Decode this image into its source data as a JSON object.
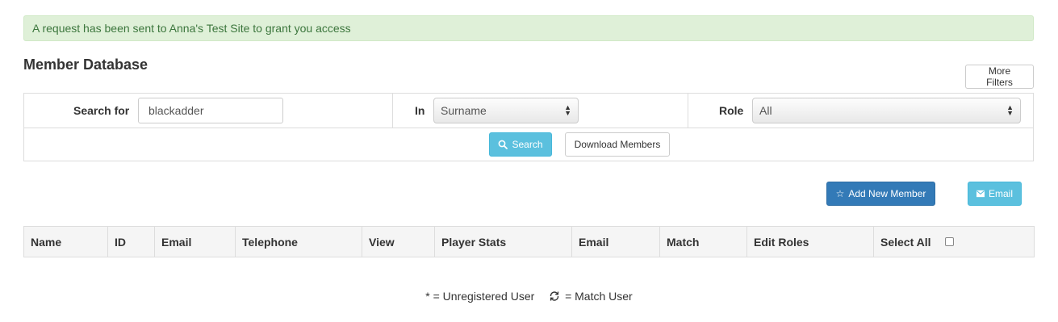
{
  "alert": {
    "message": "A request has been sent to Anna's Test Site to grant you access"
  },
  "page": {
    "title": "Member Database"
  },
  "toolbar": {
    "more_filters_label": "More Filters"
  },
  "filters": {
    "search_label": "Search for",
    "search_value": "blackadder",
    "in_label": "In",
    "in_value": "Surname",
    "role_label": "Role",
    "role_value": "All"
  },
  "actions": {
    "search_label": "Search",
    "download_label": "Download Members",
    "add_member_label": "Add New Member",
    "email_label": "Email"
  },
  "table": {
    "columns": [
      "Name",
      "ID",
      "Email",
      "Telephone",
      "View",
      "Player Stats",
      "Email",
      "Match",
      "Edit Roles",
      "Select All"
    ],
    "rows": []
  },
  "legend": {
    "unregistered": "* = Unregistered User",
    "match_user": "= Match User"
  },
  "colors": {
    "alert_bg": "#dff0d8",
    "alert_text": "#3c763d",
    "info": "#5bc0de",
    "primary": "#337ab7"
  },
  "icons": {
    "search": "search-icon",
    "add_member": "star-icon",
    "email": "envelope-icon",
    "match": "refresh-icon"
  }
}
